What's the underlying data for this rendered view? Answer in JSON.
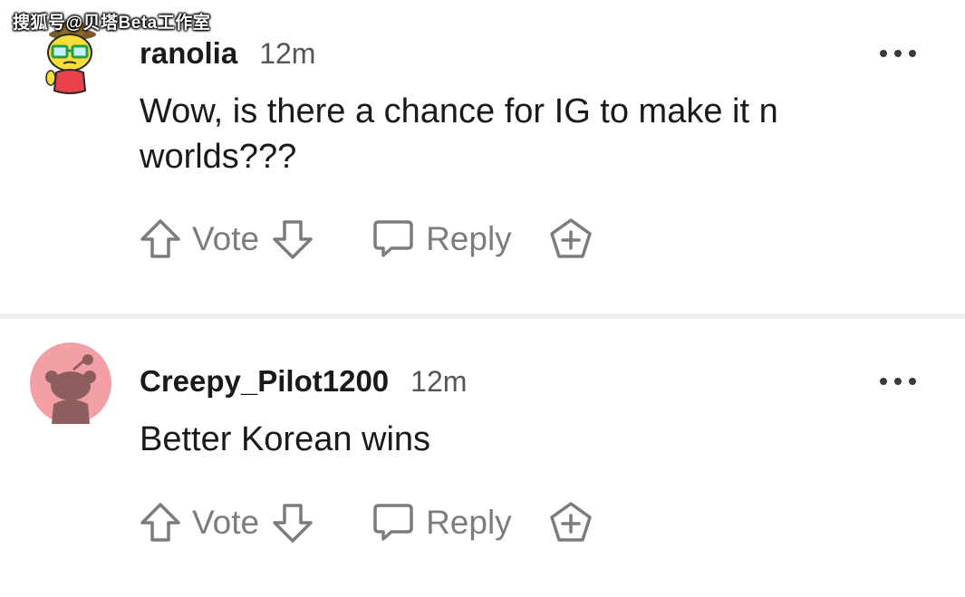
{
  "watermark": "搜狐号@贝塔Beta工作室",
  "comments": [
    {
      "username": "ranolia",
      "time": "12m",
      "text": "Wow, is there a chance for IG to make it n worlds???",
      "vote_label": "Vote",
      "reply_label": "Reply",
      "avatar_icon": "snoo-avatar-glasses-hat"
    },
    {
      "username": "Creepy_Pilot1200",
      "time": "12m",
      "text": "Better Korean wins",
      "vote_label": "Vote",
      "reply_label": "Reply",
      "avatar_icon": "default-snoo-avatar"
    }
  ],
  "icons": {
    "upvote": "upvote-arrow-icon",
    "downvote": "downvote-arrow-icon",
    "reply": "speech-bubble-icon",
    "award": "award-plus-icon",
    "more": "more-dots-icon"
  },
  "colors": {
    "text": "#1a1a1b",
    "muted": "#7c7c7c",
    "avatar_pink": "#f2a0a6",
    "avatar_yellow": "#f6dd3a",
    "divider": "#efefef"
  }
}
